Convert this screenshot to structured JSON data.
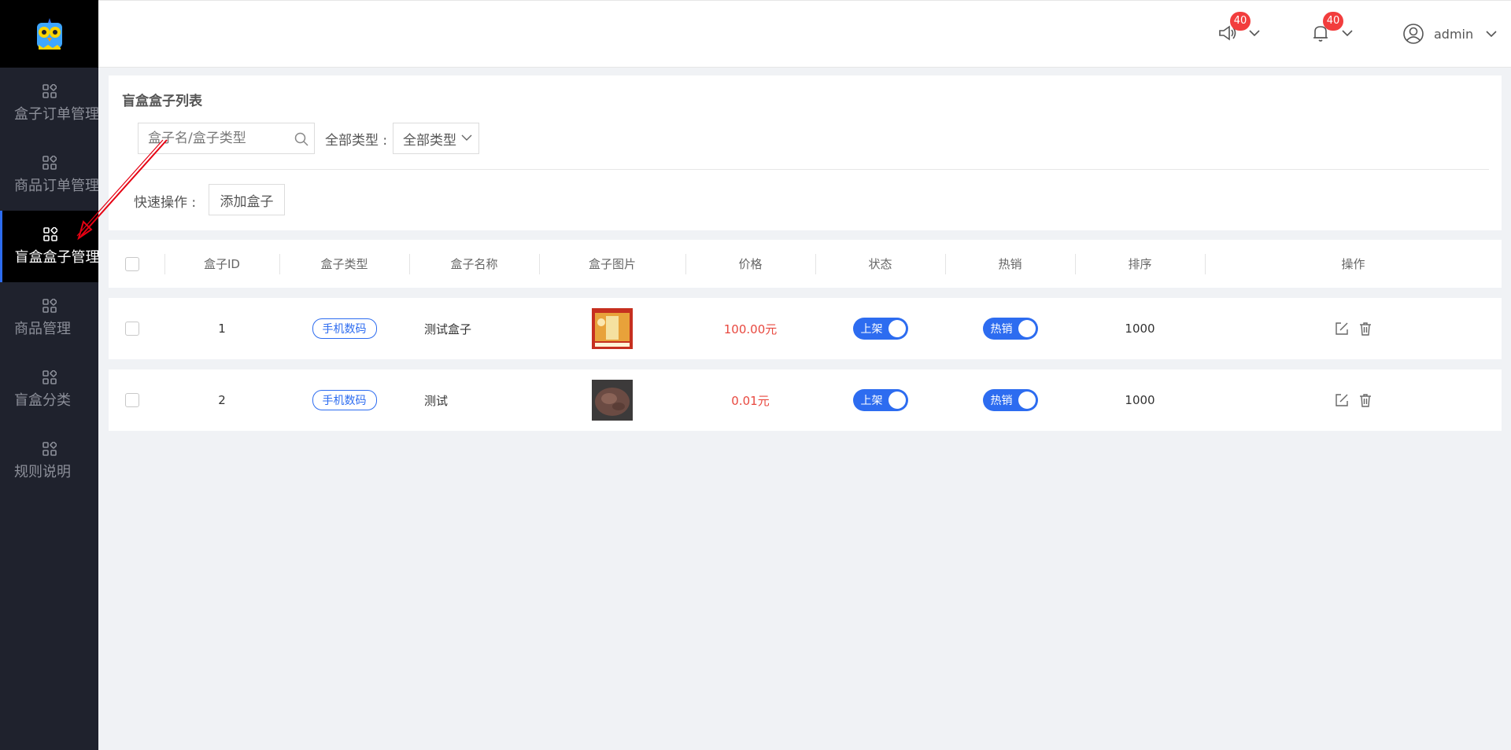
{
  "sidebar": {
    "logo_icon": "owl-logo-icon",
    "items": [
      {
        "label": "盒子订单管理",
        "icon": "grid-icon",
        "active": false
      },
      {
        "label": "商品订单管理",
        "icon": "grid-icon",
        "active": false
      },
      {
        "label": "盲盒盒子管理",
        "icon": "grid-icon",
        "active": true
      },
      {
        "label": "商品管理",
        "icon": "grid-icon",
        "active": false
      },
      {
        "label": "盲盒分类",
        "icon": "grid-icon",
        "active": false
      },
      {
        "label": "规则说明",
        "icon": "grid-icon",
        "active": false
      }
    ]
  },
  "header": {
    "announce_badge": "40",
    "bell_badge": "40",
    "user_name": "admin"
  },
  "panel": {
    "title": "盲盒盒子列表",
    "search_placeholder": "盒子名/盒子类型",
    "type_label": "全部类型 :",
    "type_value": "全部类型",
    "quick_label": "快速操作 :",
    "add_button": "添加盒子"
  },
  "table": {
    "columns": [
      "盒子ID",
      "盒子类型",
      "盒子名称",
      "盒子图片",
      "价格",
      "状态",
      "热销",
      "排序",
      "操作"
    ],
    "rows": [
      {
        "id": "1",
        "type": "手机数码",
        "name": "测试盒子",
        "price": "100.00元",
        "status": "上架",
        "hot": "热销",
        "sort": "1000"
      },
      {
        "id": "2",
        "type": "手机数码",
        "name": "测试",
        "price": "0.01元",
        "status": "上架",
        "hot": "热销",
        "sort": "1000"
      }
    ]
  },
  "colors": {
    "accent": "#2d6cf0",
    "sidebar_bg": "#1f222d",
    "price": "#e8483f",
    "badge": "#f23d3d"
  }
}
